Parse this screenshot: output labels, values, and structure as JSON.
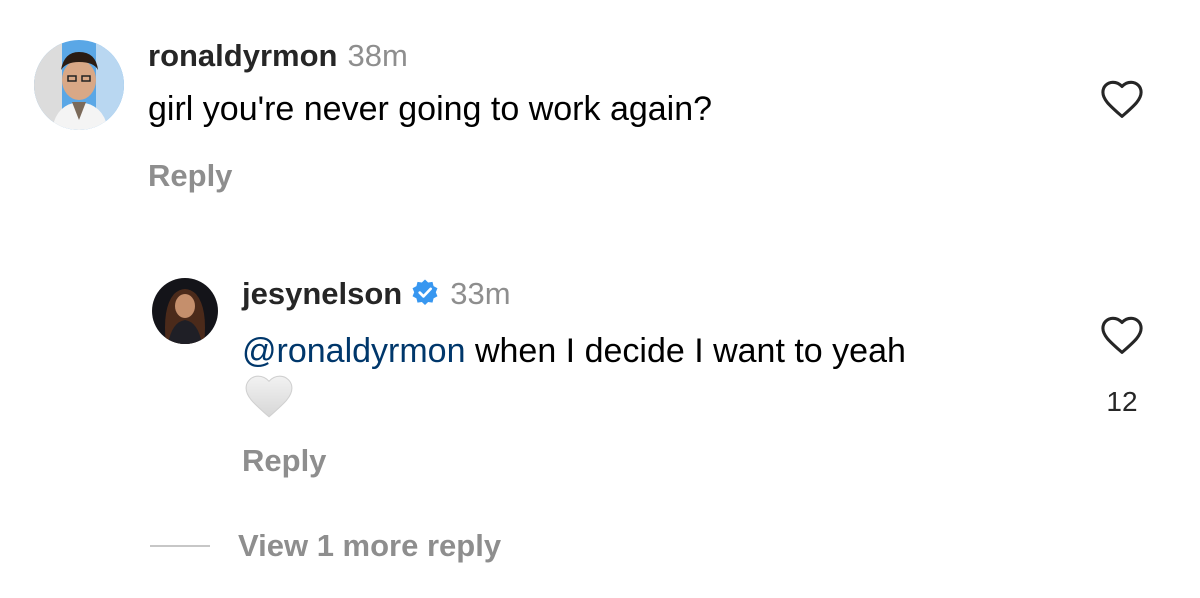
{
  "comment": {
    "username": "ronaldyrmon",
    "time": "38m",
    "text": "girl you're never going to work again?",
    "reply_label": "Reply"
  },
  "reply": {
    "username": "jesynelson",
    "time": "33m",
    "mention": "@ronaldyrmon",
    "text": " when I decide I want to yeah",
    "reply_label": "Reply",
    "like_count": "12",
    "emoji": "white-heart"
  },
  "view_more_label": "View 1 more reply",
  "colors": {
    "mention": "#00376b",
    "secondary_text": "#8e8e8e",
    "verified": "#3897f0"
  }
}
